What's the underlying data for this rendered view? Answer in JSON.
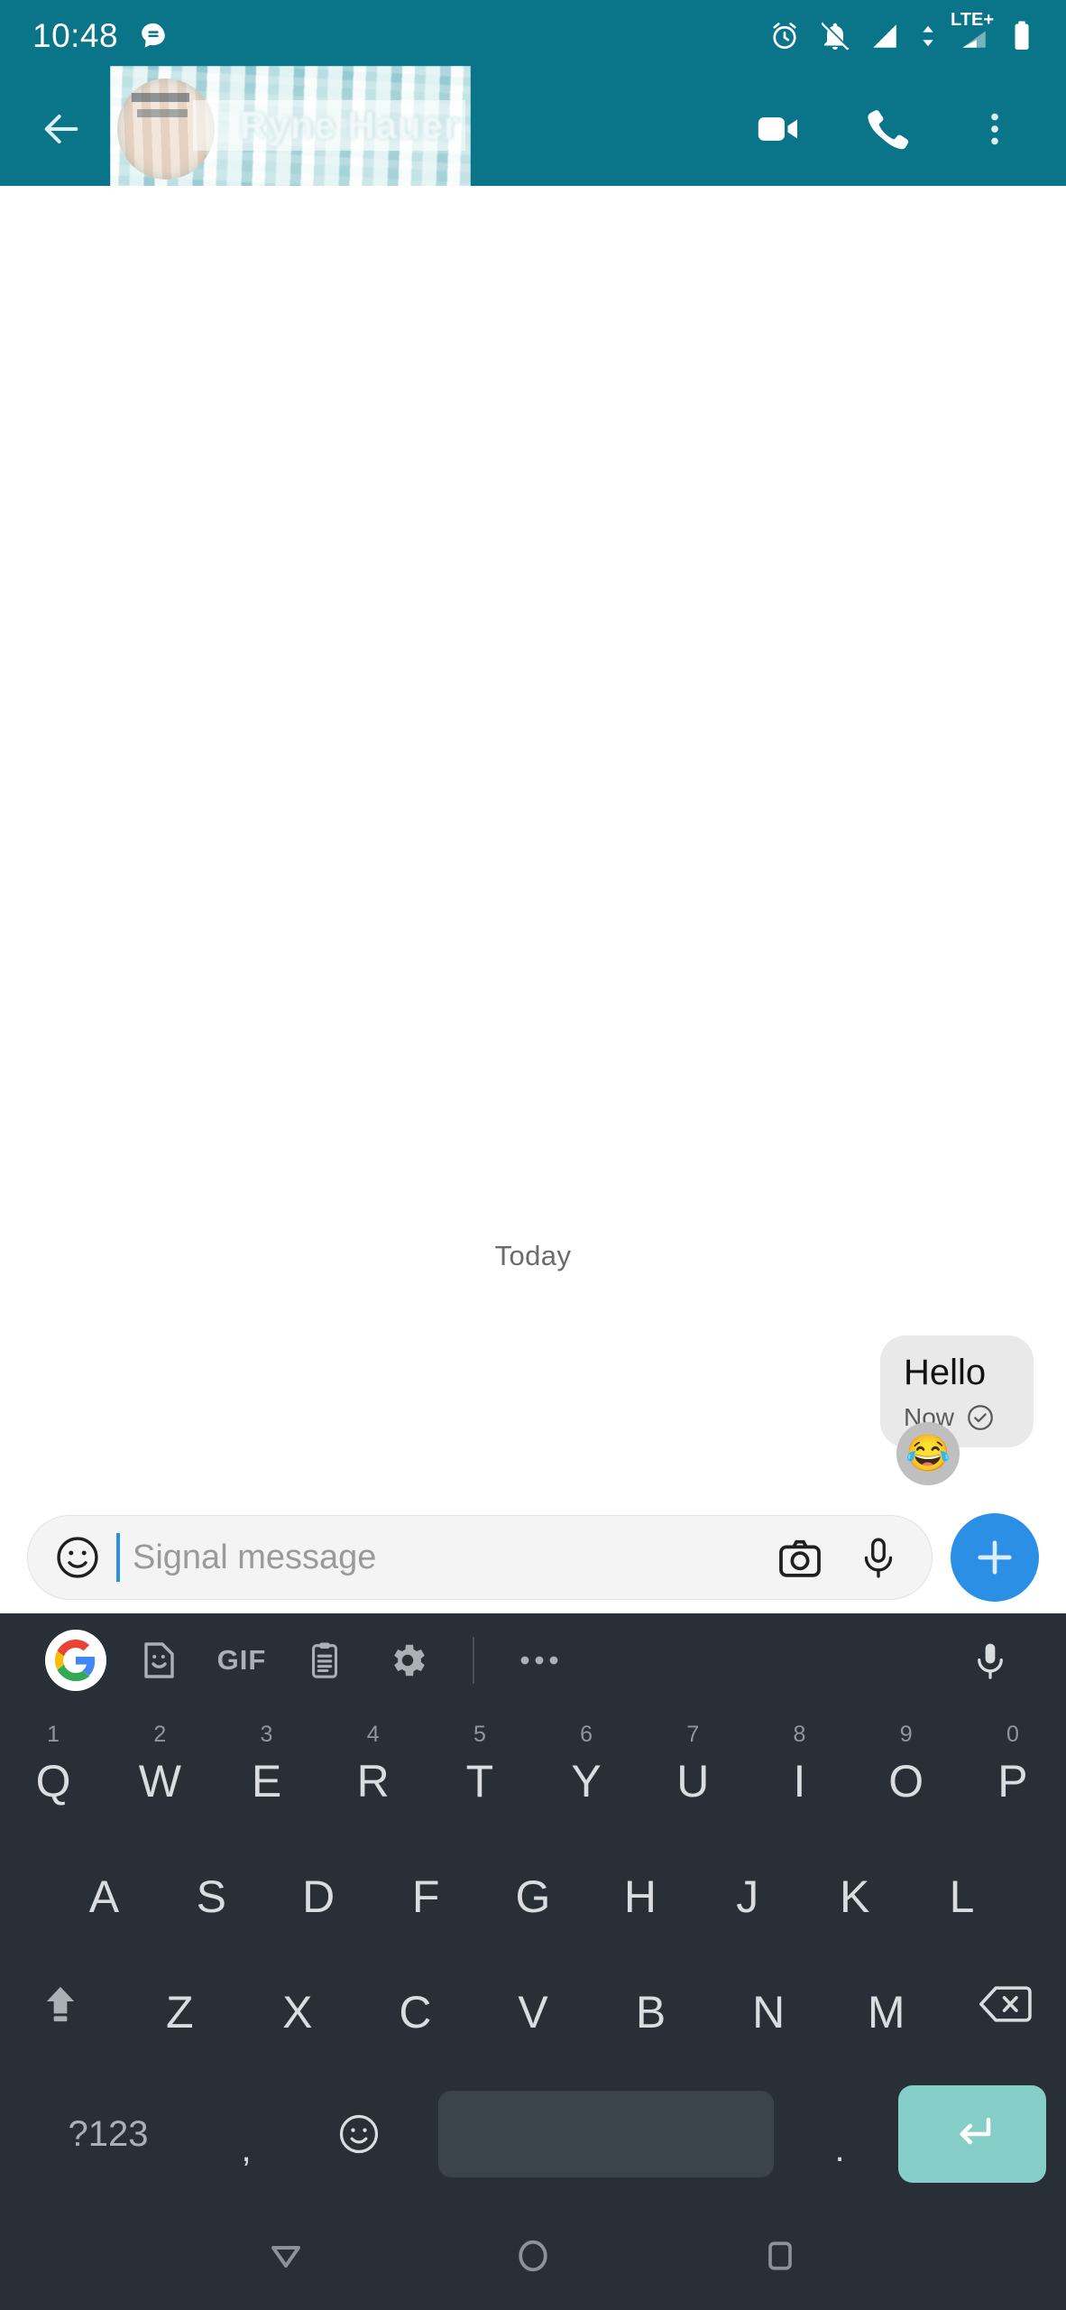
{
  "statusbar": {
    "time": "10:48",
    "icons": {
      "notification": "message-notification-icon",
      "alarm": "alarm-clock-icon",
      "mute": "bell-muted-icon",
      "signal1": "signal-full-icon",
      "data": "data-transfer-icon",
      "network_label": "LTE+",
      "signal2": "signal-partial-icon",
      "battery": "battery-full-icon"
    }
  },
  "appbar": {
    "back": "back-arrow-icon",
    "contact_name": "Ryne Hauer",
    "video_call": "video-call-icon",
    "voice_call": "phone-call-icon",
    "overflow": "more-vertical-icon",
    "bg_color": "#0A7489"
  },
  "conversation": {
    "day_divider": "Today",
    "messages": [
      {
        "text": "Hello",
        "time": "Now",
        "status": "delivered",
        "reaction": "😂",
        "outgoing": true
      }
    ]
  },
  "compose": {
    "emoji_icon": "emoji-smiley-icon",
    "placeholder": "Signal message",
    "value": "",
    "camera_icon": "camera-icon",
    "mic_icon": "microphone-icon",
    "attach_label": "+",
    "accent_color": "#2C8FE6"
  },
  "keyboard": {
    "toolbar": {
      "google": "google-logo-icon",
      "sticker": "sticker-icon",
      "gif": "GIF",
      "clipboard": "clipboard-icon",
      "settings": "settings-gear-icon",
      "more": "more-horizontal-icon",
      "voice": "microphone-icon"
    },
    "row1": [
      {
        "letter": "Q",
        "num": "1"
      },
      {
        "letter": "W",
        "num": "2"
      },
      {
        "letter": "E",
        "num": "3"
      },
      {
        "letter": "R",
        "num": "4"
      },
      {
        "letter": "T",
        "num": "5"
      },
      {
        "letter": "Y",
        "num": "6"
      },
      {
        "letter": "U",
        "num": "7"
      },
      {
        "letter": "I",
        "num": "8"
      },
      {
        "letter": "O",
        "num": "9"
      },
      {
        "letter": "P",
        "num": "0"
      }
    ],
    "row2": [
      "A",
      "S",
      "D",
      "F",
      "G",
      "H",
      "J",
      "K",
      "L"
    ],
    "row3": [
      "Z",
      "X",
      "C",
      "V",
      "B",
      "N",
      "M"
    ],
    "shift": "shift-icon",
    "backspace": "backspace-icon",
    "bottom": {
      "symbols": "?123",
      "comma": ",",
      "emoji": "emoji-smiley-icon",
      "space": "",
      "period": ".",
      "enter": "enter-icon"
    },
    "bg_color": "#292F36",
    "enter_color": "#86CFC9"
  },
  "navbar": {
    "back": "nav-back-triangle-icon",
    "home": "nav-home-circle-icon",
    "recents": "nav-recents-square-icon"
  }
}
